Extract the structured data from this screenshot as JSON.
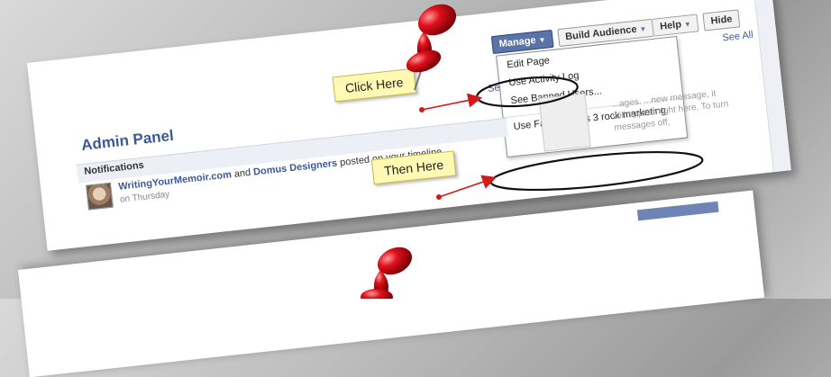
{
  "admin_panel": {
    "title": "Admin Panel",
    "see_link": "See",
    "see_all": "See All"
  },
  "topbar": {
    "manage_label": "Manage",
    "build_audience_label": "Build Audience",
    "help_label": "Help",
    "hide_label": "Hide"
  },
  "manage_menu": {
    "items": [
      "Edit Page",
      "Use Activity Log",
      "See Banned Users...",
      "Use Facebook as 3 rock marketing"
    ]
  },
  "notifications": {
    "title": "Notifications",
    "user1": "WritingYourMemoir.com",
    "joiner": "and",
    "user2": "Domus Designers",
    "action": "posted on your timeline.",
    "time": "on Thursday"
  },
  "messages": {
    "text": "...ages. ...new message, it will appear right here. To turn messages off,"
  },
  "callouts": {
    "first": "Click Here",
    "second": "Then Here"
  },
  "colors": {
    "facebook_blue": "#3b5998",
    "callout_yellow": "#fff9b4",
    "arrow_red": "#d11a1a",
    "pin_red": "#e0101a"
  }
}
